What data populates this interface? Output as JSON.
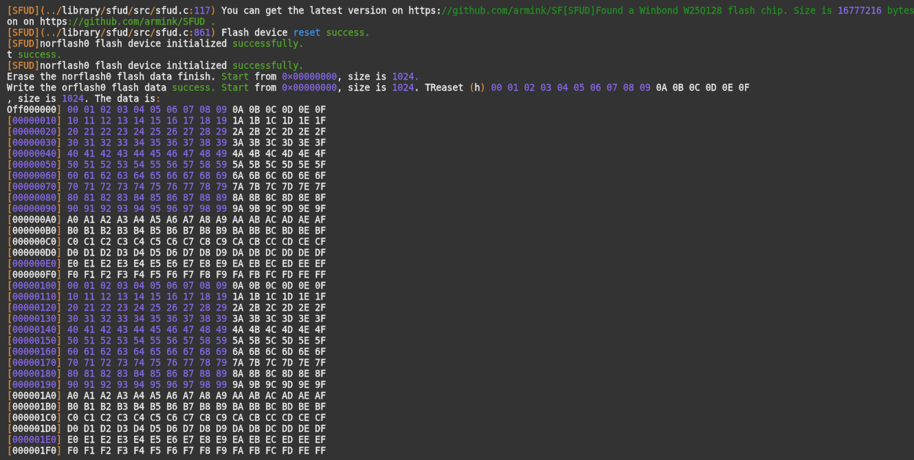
{
  "terminal": {
    "lines": [
      {
        "segments": [
          {
            "text": "[SFUD](../",
            "color": "#d7883a"
          },
          {
            "text": "library",
            "color": "#e8e8e8"
          },
          {
            "text": "/",
            "color": "#d7883a"
          },
          {
            "text": "sfud",
            "color": "#e8e8e8"
          },
          {
            "text": "/",
            "color": "#d7883a"
          },
          {
            "text": "src",
            "color": "#e8e8e8"
          },
          {
            "text": "/",
            "color": "#d7883a"
          },
          {
            "text": "sfud.c",
            "color": "#e8e8e8"
          },
          {
            "text": ":",
            "color": "#d7883a"
          },
          {
            "text": "117",
            "color": "#8466e0"
          },
          {
            "text": ")",
            "color": "#d7883a"
          },
          {
            "text": " You can get the latest version on https:",
            "color": "#e8e8e8"
          },
          {
            "text": "//github.com/armink/SF[SFUD]Found a Winbond W25Q128 flash chip. Size is ",
            "color": "#238c23"
          },
          {
            "text": "16777216",
            "color": "#8466e0"
          },
          {
            "text": " bytes",
            "color": "#238c23"
          }
        ]
      },
      {
        "segments": [
          {
            "text": "on on https",
            "color": "#e8e8e8"
          },
          {
            "text": "://github.com/armink/SFUD .",
            "color": "#52a02c"
          }
        ]
      },
      {
        "segments": [
          {
            "text": "[SFUD](../",
            "color": "#d7883a"
          },
          {
            "text": "library",
            "color": "#e8e8e8"
          },
          {
            "text": "/",
            "color": "#d7883a"
          },
          {
            "text": "sfud",
            "color": "#e8e8e8"
          },
          {
            "text": "/",
            "color": "#d7883a"
          },
          {
            "text": "src",
            "color": "#e8e8e8"
          },
          {
            "text": "/",
            "color": "#d7883a"
          },
          {
            "text": "sfud.c",
            "color": "#e8e8e8"
          },
          {
            "text": ":",
            "color": "#d7883a"
          },
          {
            "text": "861",
            "color": "#8466e0"
          },
          {
            "text": ")",
            "color": "#d7883a"
          },
          {
            "text": " Flash device ",
            "color": "#e8e8e8"
          },
          {
            "text": "reset",
            "color": "#3f8fe0"
          },
          {
            "text": " success.",
            "color": "#52a02c"
          }
        ]
      },
      {
        "segments": [
          {
            "text": "[SFUD]",
            "color": "#d7883a"
          },
          {
            "text": "norflash0 flash device initialized ",
            "color": "#e8e8e8"
          },
          {
            "text": "successfully.",
            "color": "#52a02c"
          }
        ]
      },
      {
        "segments": [
          {
            "text": "t ",
            "color": "#e8e8e8"
          },
          {
            "text": "success.",
            "color": "#52a02c"
          }
        ]
      },
      {
        "segments": [
          {
            "text": "[SFUD]",
            "color": "#d7883a"
          },
          {
            "text": "norflash0 flash device initialized ",
            "color": "#e8e8e8"
          },
          {
            "text": "successfully.",
            "color": "#52a02c"
          }
        ]
      },
      {
        "segments": [
          {
            "text": "Erase the norflash0 flash data finish. ",
            "color": "#e8e8e8"
          },
          {
            "text": "Start",
            "color": "#52a02c"
          },
          {
            "text": " from ",
            "color": "#e8e8e8"
          },
          {
            "text": "0×00000000",
            "color": "#8466e0"
          },
          {
            "text": ", size is ",
            "color": "#e8e8e8"
          },
          {
            "text": "1024.",
            "color": "#8466e0"
          }
        ]
      },
      {
        "segments": [
          {
            "text": "Write the orflash0 flash data ",
            "color": "#e8e8e8"
          },
          {
            "text": "success. Start",
            "color": "#52a02c"
          },
          {
            "text": " from ",
            "color": "#e8e8e8"
          },
          {
            "text": "0×00000000",
            "color": "#8466e0"
          },
          {
            "text": ", size is ",
            "color": "#e8e8e8"
          },
          {
            "text": "1024",
            "color": "#8466e0"
          },
          {
            "text": ". TReaset ",
            "color": "#e8e8e8"
          },
          {
            "text": "(",
            "color": "#d7883a"
          },
          {
            "text": "h",
            "color": "#e8e8e8"
          },
          {
            "text": ")",
            "color": "#d7883a"
          },
          {
            "text": " 00 01 02 03 04 05 06 07 08 09",
            "color": "#8466e0"
          },
          {
            "text": " 0A 0B 0C 0D 0E 0F",
            "color": "#e8e8e8"
          }
        ]
      },
      {
        "segments": [
          {
            "text": ", size is ",
            "color": "#e8e8e8"
          },
          {
            "text": "1024",
            "color": "#8466e0"
          },
          {
            "text": ". The data is",
            "color": "#e8e8e8"
          },
          {
            "text": ":",
            "color": "#d7883a"
          }
        ]
      },
      {
        "segments": [
          {
            "text": "Off000000",
            "color": "#e8e8e8"
          },
          {
            "text": "]",
            "color": "#d7883a"
          },
          {
            "text": " 00 01 02 03 04 05 06 07 08 09",
            "color": "#8466e0"
          },
          {
            "text": " 0A 0B 0C 0D 0E 0F",
            "color": "#e8e8e8"
          }
        ]
      },
      {
        "segments": [
          {
            "text": "[",
            "color": "#d7883a"
          },
          {
            "text": "00000010",
            "color": "#8466e0"
          },
          {
            "text": "]",
            "color": "#d7883a"
          },
          {
            "text": " 10 11 12 13 14 15 16 17 18 19",
            "color": "#8466e0"
          },
          {
            "text": " 1A 1B 1C 1D 1E 1F",
            "color": "#e8e8e8"
          }
        ]
      },
      {
        "segments": [
          {
            "text": "[",
            "color": "#d7883a"
          },
          {
            "text": "00000020",
            "color": "#8466e0"
          },
          {
            "text": "]",
            "color": "#d7883a"
          },
          {
            "text": " 20 21 22 23 24 25 26 27 28 29",
            "color": "#8466e0"
          },
          {
            "text": " 2A 2B 2C 2D 2E 2F",
            "color": "#e8e8e8"
          }
        ]
      },
      {
        "segments": [
          {
            "text": "[",
            "color": "#d7883a"
          },
          {
            "text": "00000030",
            "color": "#8466e0"
          },
          {
            "text": "]",
            "color": "#d7883a"
          },
          {
            "text": " 30 31 32 33 34 35 36 37 38 39",
            "color": "#8466e0"
          },
          {
            "text": " 3A 3B 3C 3D 3E 3F",
            "color": "#e8e8e8"
          }
        ]
      },
      {
        "segments": [
          {
            "text": "[",
            "color": "#d7883a"
          },
          {
            "text": "00000040",
            "color": "#8466e0"
          },
          {
            "text": "]",
            "color": "#d7883a"
          },
          {
            "text": " 40 41 42 43 44 45 46 47 48 49",
            "color": "#8466e0"
          },
          {
            "text": " 4A 4B 4C 4D 4E 4F",
            "color": "#e8e8e8"
          }
        ]
      },
      {
        "segments": [
          {
            "text": "[",
            "color": "#d7883a"
          },
          {
            "text": "00000050",
            "color": "#8466e0"
          },
          {
            "text": "]",
            "color": "#d7883a"
          },
          {
            "text": " 50 51 52 53 54 55 56 57 58 59",
            "color": "#8466e0"
          },
          {
            "text": " 5A 5B 5C 5D 5E 5F",
            "color": "#e8e8e8"
          }
        ]
      },
      {
        "segments": [
          {
            "text": "[",
            "color": "#d7883a"
          },
          {
            "text": "00000060",
            "color": "#8466e0"
          },
          {
            "text": "]",
            "color": "#d7883a"
          },
          {
            "text": " 60 61 62 63 64 65 66 67 68 69",
            "color": "#8466e0"
          },
          {
            "text": " 6A 6B 6C 6D 6E 6F",
            "color": "#e8e8e8"
          }
        ]
      },
      {
        "segments": [
          {
            "text": "[",
            "color": "#d7883a"
          },
          {
            "text": "00000070",
            "color": "#8466e0"
          },
          {
            "text": "]",
            "color": "#d7883a"
          },
          {
            "text": " 70 71 72 73 74 75 76 77 78 79",
            "color": "#8466e0"
          },
          {
            "text": " 7A 7B 7C 7D 7E 7F",
            "color": "#e8e8e8"
          }
        ]
      },
      {
        "segments": [
          {
            "text": "[",
            "color": "#d7883a"
          },
          {
            "text": "00000080",
            "color": "#8466e0"
          },
          {
            "text": "]",
            "color": "#d7883a"
          },
          {
            "text": " 80 81 82 83 84 85 86 87 88 89",
            "color": "#8466e0"
          },
          {
            "text": " 8A 8B 8C 8D 8E 8F",
            "color": "#e8e8e8"
          }
        ]
      },
      {
        "segments": [
          {
            "text": "[",
            "color": "#d7883a"
          },
          {
            "text": "00000090",
            "color": "#8466e0"
          },
          {
            "text": "]",
            "color": "#d7883a"
          },
          {
            "text": " 90 91 92 93 94 95 96 97 98 99",
            "color": "#8466e0"
          },
          {
            "text": " 9A 9B 9C 9D 9E 9F",
            "color": "#e8e8e8"
          }
        ]
      },
      {
        "segments": [
          {
            "text": "[",
            "color": "#d7883a"
          },
          {
            "text": "000000A0",
            "color": "#e8e8e8"
          },
          {
            "text": "]",
            "color": "#d7883a"
          },
          {
            "text": " A0 A1 A2 A3 A4 A5 A6 A7 A8 A9 AA AB AC AD AE AF",
            "color": "#e8e8e8"
          }
        ]
      },
      {
        "segments": [
          {
            "text": "[",
            "color": "#d7883a"
          },
          {
            "text": "000000B0",
            "color": "#e8e8e8"
          },
          {
            "text": "]",
            "color": "#d7883a"
          },
          {
            "text": " B0 B1 B2 B3 B4 B5 B6 B7 B8 B9 BA BB BC BD BE BF",
            "color": "#e8e8e8"
          }
        ]
      },
      {
        "segments": [
          {
            "text": "[",
            "color": "#d7883a"
          },
          {
            "text": "000000C0",
            "color": "#e8e8e8"
          },
          {
            "text": "]",
            "color": "#d7883a"
          },
          {
            "text": " C0 C1 C2 C3 C4 C5 C6 C7 C8 C9 CA CB CC CD CE CF",
            "color": "#e8e8e8"
          }
        ]
      },
      {
        "segments": [
          {
            "text": "[",
            "color": "#d7883a"
          },
          {
            "text": "000000D0",
            "color": "#e8e8e8"
          },
          {
            "text": "]",
            "color": "#d7883a"
          },
          {
            "text": " D0 D1 D2 D3 D4 D5 D6 D7 D8 D9 DA DB DC DD DE DF",
            "color": "#e8e8e8"
          }
        ]
      },
      {
        "segments": [
          {
            "text": "[",
            "color": "#d7883a"
          },
          {
            "text": "000000E0",
            "color": "#8466e0"
          },
          {
            "text": "]",
            "color": "#d7883a"
          },
          {
            "text": " E0 E1 E2 E3 E4 E5 E6 E7 E8 E9 EA EB EC ED EE EF",
            "color": "#e8e8e8"
          }
        ]
      },
      {
        "segments": [
          {
            "text": "[",
            "color": "#d7883a"
          },
          {
            "text": "000000F0",
            "color": "#e8e8e8"
          },
          {
            "text": "]",
            "color": "#d7883a"
          },
          {
            "text": " F0 F1 F2 F3 F4 F5 F6 F7 F8 F9 FA FB FC FD FE FF",
            "color": "#e8e8e8"
          }
        ]
      },
      {
        "segments": [
          {
            "text": "[",
            "color": "#d7883a"
          },
          {
            "text": "00000100",
            "color": "#8466e0"
          },
          {
            "text": "]",
            "color": "#d7883a"
          },
          {
            "text": " 00 01 02 03 04 05 06 07 08 09",
            "color": "#8466e0"
          },
          {
            "text": " 0A 0B 0C 0D 0E 0F",
            "color": "#e8e8e8"
          }
        ]
      },
      {
        "segments": [
          {
            "text": "[",
            "color": "#d7883a"
          },
          {
            "text": "00000110",
            "color": "#8466e0"
          },
          {
            "text": "]",
            "color": "#d7883a"
          },
          {
            "text": " 10 11 12 13 14 15 16 17 18 19",
            "color": "#8466e0"
          },
          {
            "text": " 1A 1B 1C 1D 1E 1F",
            "color": "#e8e8e8"
          }
        ]
      },
      {
        "segments": [
          {
            "text": "[",
            "color": "#d7883a"
          },
          {
            "text": "00000120",
            "color": "#8466e0"
          },
          {
            "text": "]",
            "color": "#d7883a"
          },
          {
            "text": " 20 21 22 23 24 25 26 27 28 29",
            "color": "#8466e0"
          },
          {
            "text": " 2A 2B 2C 2D 2E 2F",
            "color": "#e8e8e8"
          }
        ]
      },
      {
        "segments": [
          {
            "text": "[",
            "color": "#d7883a"
          },
          {
            "text": "00000130",
            "color": "#8466e0"
          },
          {
            "text": "]",
            "color": "#d7883a"
          },
          {
            "text": " 30 31 32 33 34 35 36 37 38 39",
            "color": "#8466e0"
          },
          {
            "text": " 3A 3B 3C 3D 3E 3F",
            "color": "#e8e8e8"
          }
        ]
      },
      {
        "segments": [
          {
            "text": "[",
            "color": "#d7883a"
          },
          {
            "text": "00000140",
            "color": "#8466e0"
          },
          {
            "text": "]",
            "color": "#d7883a"
          },
          {
            "text": " 40 41 42 43 44 45 46 47 48 49",
            "color": "#8466e0"
          },
          {
            "text": " 4A 4B 4C 4D 4E 4F",
            "color": "#e8e8e8"
          }
        ]
      },
      {
        "segments": [
          {
            "text": "[",
            "color": "#d7883a"
          },
          {
            "text": "00000150",
            "color": "#8466e0"
          },
          {
            "text": "]",
            "color": "#d7883a"
          },
          {
            "text": " 50 51 52 53 54 55 56 57 58 59",
            "color": "#8466e0"
          },
          {
            "text": " 5A 5B 5C 5D 5E 5F",
            "color": "#e8e8e8"
          }
        ]
      },
      {
        "segments": [
          {
            "text": "[",
            "color": "#d7883a"
          },
          {
            "text": "00000160",
            "color": "#8466e0"
          },
          {
            "text": "]",
            "color": "#d7883a"
          },
          {
            "text": " 60 61 62 63 64 65 66 67 68 69",
            "color": "#8466e0"
          },
          {
            "text": " 6A 6B 6C 6D 6E 6F",
            "color": "#e8e8e8"
          }
        ]
      },
      {
        "segments": [
          {
            "text": "[",
            "color": "#d7883a"
          },
          {
            "text": "00000170",
            "color": "#8466e0"
          },
          {
            "text": "]",
            "color": "#d7883a"
          },
          {
            "text": " 70 71 72 73 74 75 76 77 78 79",
            "color": "#8466e0"
          },
          {
            "text": " 7A 7B 7C 7D 7E 7F",
            "color": "#e8e8e8"
          }
        ]
      },
      {
        "segments": [
          {
            "text": "[",
            "color": "#d7883a"
          },
          {
            "text": "00000180",
            "color": "#8466e0"
          },
          {
            "text": "]",
            "color": "#d7883a"
          },
          {
            "text": " 80 81 82 83 84 85 86 87 88 89",
            "color": "#8466e0"
          },
          {
            "text": " 8A 8B 8C 8D 8E 8F",
            "color": "#e8e8e8"
          }
        ]
      },
      {
        "segments": [
          {
            "text": "[",
            "color": "#d7883a"
          },
          {
            "text": "00000190",
            "color": "#8466e0"
          },
          {
            "text": "]",
            "color": "#d7883a"
          },
          {
            "text": " 90 91 92 93 94 95 96 97 98 99",
            "color": "#8466e0"
          },
          {
            "text": " 9A 9B 9C 9D 9E 9F",
            "color": "#e8e8e8"
          }
        ]
      },
      {
        "segments": [
          {
            "text": "[",
            "color": "#d7883a"
          },
          {
            "text": "000001A0",
            "color": "#e8e8e8"
          },
          {
            "text": "]",
            "color": "#d7883a"
          },
          {
            "text": " A0 A1 A2 A3 A4 A5 A6 A7 A8 A9 AA AB AC AD AE AF",
            "color": "#e8e8e8"
          }
        ]
      },
      {
        "segments": [
          {
            "text": "[",
            "color": "#d7883a"
          },
          {
            "text": "000001B0",
            "color": "#e8e8e8"
          },
          {
            "text": "]",
            "color": "#d7883a"
          },
          {
            "text": " B0 B1 B2 B3 B4 B5 B6 B7 B8 B9 BA BB BC BD BE BF",
            "color": "#e8e8e8"
          }
        ]
      },
      {
        "segments": [
          {
            "text": "[",
            "color": "#d7883a"
          },
          {
            "text": "000001C0",
            "color": "#e8e8e8"
          },
          {
            "text": "]",
            "color": "#d7883a"
          },
          {
            "text": " C0 C1 C2 C3 C4 C5 C6 C7 C8 C9 CA CB CC CD CE CF",
            "color": "#e8e8e8"
          }
        ]
      },
      {
        "segments": [
          {
            "text": "[",
            "color": "#d7883a"
          },
          {
            "text": "000001D0",
            "color": "#e8e8e8"
          },
          {
            "text": "]",
            "color": "#d7883a"
          },
          {
            "text": " D0 D1 D2 D3 D4 D5 D6 D7 D8 D9 DA DB DC DD DE DF",
            "color": "#e8e8e8"
          }
        ]
      },
      {
        "segments": [
          {
            "text": "[",
            "color": "#d7883a"
          },
          {
            "text": "000001E0",
            "color": "#8466e0"
          },
          {
            "text": "]",
            "color": "#d7883a"
          },
          {
            "text": " E0 E1 E2 E3 E4 E5 E6 E7 E8 E9 EA EB EC ED EE EF",
            "color": "#e8e8e8"
          }
        ]
      },
      {
        "segments": [
          {
            "text": "[",
            "color": "#d7883a"
          },
          {
            "text": "000001F0",
            "color": "#e8e8e8"
          },
          {
            "text": "]",
            "color": "#d7883a"
          },
          {
            "text": " F0 F1 F2 F3 F4 F5 F6 F7 F8 F9 FA FB FC FD FE FF",
            "color": "#e8e8e8"
          }
        ]
      }
    ]
  }
}
